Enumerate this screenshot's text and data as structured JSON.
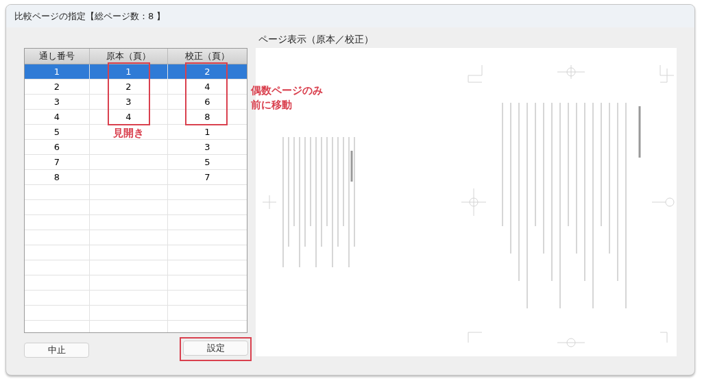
{
  "window": {
    "title": "比較ページの指定【総ページ数：8 】"
  },
  "table": {
    "columns": [
      "通し番号",
      "原本（頁）",
      "校正（頁）"
    ],
    "rows": [
      {
        "number": "1",
        "original": "1",
        "proof": "2",
        "selected": true
      },
      {
        "number": "2",
        "original": "2",
        "proof": "4",
        "selected": false
      },
      {
        "number": "3",
        "original": "3",
        "proof": "6",
        "selected": false
      },
      {
        "number": "4",
        "original": "4",
        "proof": "8",
        "selected": false
      },
      {
        "number": "5",
        "proof": "1",
        "selected": false
      },
      {
        "number": "6",
        "proof": "3",
        "selected": false
      },
      {
        "number": "7",
        "proof": "5",
        "selected": false
      },
      {
        "number": "8",
        "proof": "7",
        "selected": false
      }
    ]
  },
  "annotations": [
    {
      "kind": "original",
      "text": "見開き"
    },
    {
      "kind": "proof",
      "lines": [
        "偶数ページのみ",
        "前に移動"
      ]
    }
  ],
  "preview": {
    "label": "ページ表示（原本／校正）"
  },
  "buttons": [
    {
      "label": "中止",
      "highlighted": false
    },
    {
      "label": "設定",
      "highlighted": true
    }
  ]
}
